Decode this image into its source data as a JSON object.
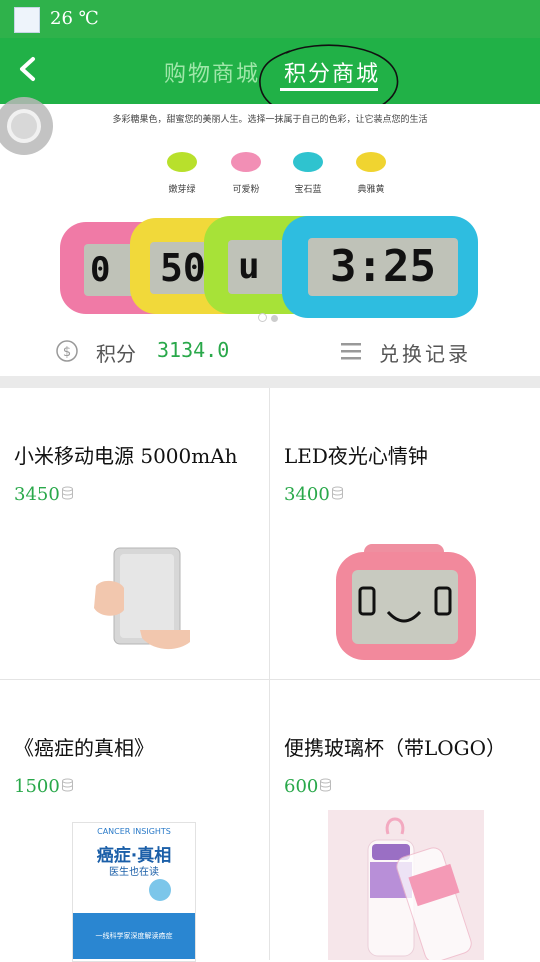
{
  "status_bar": {
    "temperature": "26 ℃"
  },
  "header": {
    "tabs": [
      {
        "label": "购物商城",
        "active": false
      },
      {
        "label": "积分商城",
        "active": true
      }
    ]
  },
  "banner": {
    "tagline": "多彩糖果色，甜蜜您的美丽人生。选择一抹属于自己的色彩，让它装点您的生活",
    "colors": [
      {
        "name": "嫩芽绿",
        "hex": "#b8e02c"
      },
      {
        "name": "可爱粉",
        "hex": "#f28fb5"
      },
      {
        "name": "宝石蓝",
        "hex": "#2fc3cf"
      },
      {
        "name": "典雅黄",
        "hex": "#f0d430"
      }
    ],
    "clock_displays": [
      "0",
      "50",
      "u",
      "3:25"
    ],
    "page_indicator": {
      "current": 1,
      "total": 2
    }
  },
  "points_bar": {
    "points_label": "积分",
    "points_value": "3134.0",
    "history_label": "兑换记录"
  },
  "products": [
    {
      "title": "小米移动电源 5000mAh",
      "price": "3450"
    },
    {
      "title": "LED夜光心情钟",
      "price": "3400"
    },
    {
      "title": "《癌症的真相》",
      "price": "1500"
    },
    {
      "title": "便携玻璃杯（带LOGO）",
      "price": "600"
    }
  ],
  "book_cover": {
    "top_text": "CANCER INSIGHTS",
    "title": "癌症·真相",
    "subtitle": "医生也在读",
    "bottom_text": "一线科学家深度解读癌症"
  },
  "colors": {
    "brand_green": "#21b147",
    "price_green": "#29a84a"
  }
}
